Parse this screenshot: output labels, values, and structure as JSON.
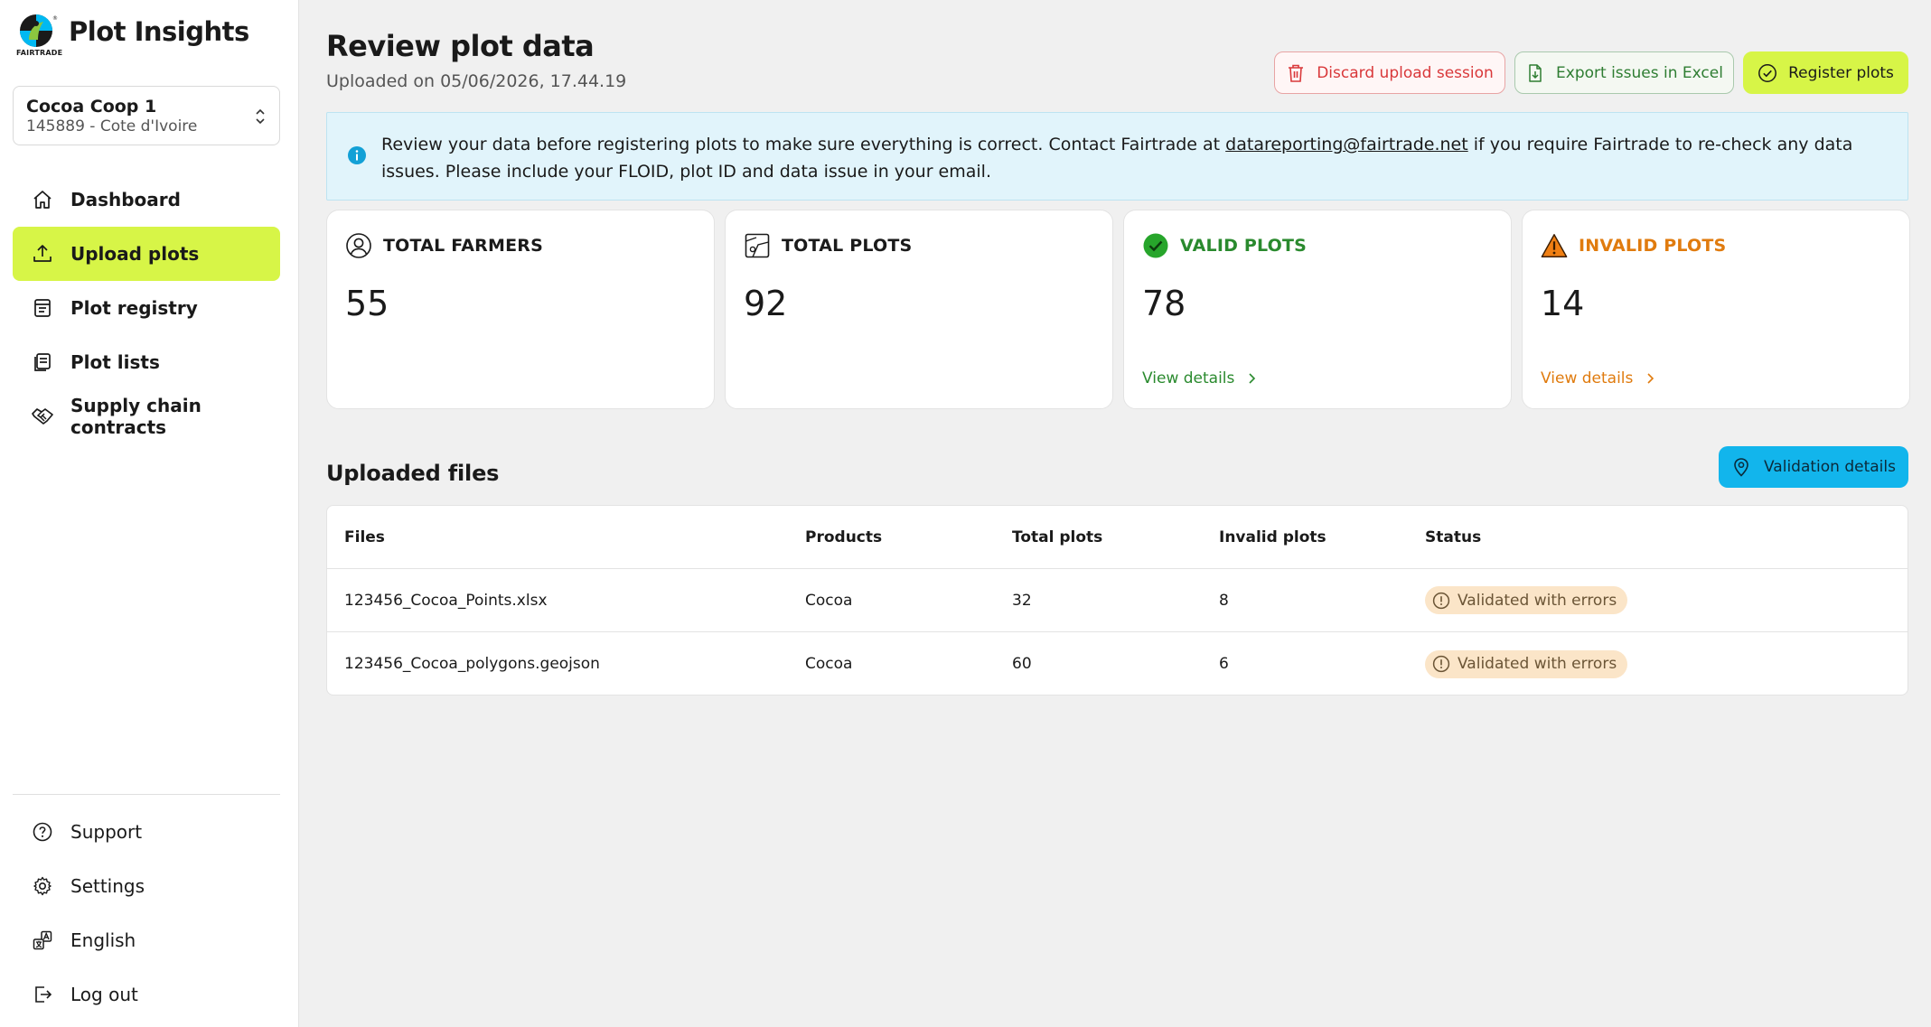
{
  "app": {
    "title": "Plot Insights",
    "logo_text": "FAIRTRADE"
  },
  "organization": {
    "name": "Cocoa Coop 1",
    "subtitle": "145889 - Cote d'Ivoire"
  },
  "sidebar": {
    "items": [
      {
        "label": "Dashboard",
        "icon": "home-icon",
        "active": false
      },
      {
        "label": "Upload plots",
        "icon": "upload-icon",
        "active": true
      },
      {
        "label": "Plot registry",
        "icon": "registry-icon",
        "active": false
      },
      {
        "label": "Plot lists",
        "icon": "lists-icon",
        "active": false
      },
      {
        "label": "Supply chain contracts",
        "icon": "handshake-icon",
        "active": false
      }
    ],
    "bottom_items": [
      {
        "label": "Support",
        "icon": "help-icon"
      },
      {
        "label": "Settings",
        "icon": "gear-icon"
      },
      {
        "label": "English",
        "icon": "language-icon"
      },
      {
        "label": "Log out",
        "icon": "logout-icon"
      }
    ]
  },
  "header": {
    "title": "Review plot data",
    "subtitle": "Uploaded on 05/06/2026, 17.44.19",
    "discard_label": "Discard upload session",
    "export_label": "Export issues in Excel",
    "register_label": "Register plots"
  },
  "banner": {
    "text_before": "Review your data before registering plots to make sure everything is correct. Contact Fairtrade at ",
    "email": "datareporting@fairtrade.net",
    "text_after": " if you require Fairtrade to re-check any data issues. Please include your FLOID, plot ID and data issue in your email."
  },
  "stats": {
    "farmers": {
      "label": "TOTAL FARMERS",
      "value": "55"
    },
    "plots": {
      "label": "TOTAL PLOTS",
      "value": "92"
    },
    "valid": {
      "label": "VALID PLOTS",
      "value": "78",
      "link": "View details"
    },
    "invalid": {
      "label": "INVALID PLOTS",
      "value": "14",
      "link": "View details"
    }
  },
  "files_section": {
    "title": "Uploaded files",
    "validation_button": "Validation details",
    "columns": [
      "Files",
      "Products",
      "Total plots",
      "Invalid plots",
      "Status"
    ],
    "rows": [
      {
        "file": "123456_Cocoa_Points.xlsx",
        "product": "Cocoa",
        "total": "32",
        "invalid": "8",
        "status": "Validated with errors"
      },
      {
        "file": "123456_Cocoa_polygons.geojson",
        "product": "Cocoa",
        "total": "60",
        "invalid": "6",
        "status": "Validated with errors"
      }
    ]
  },
  "colors": {
    "accent": "#d7f547",
    "info_bg": "#e1f4fb",
    "valid": "#2a8a2e",
    "invalid": "#e07b0e",
    "danger": "#d9383a",
    "validation_button": "#12b5ec",
    "status_badge_bg": "#fbe5c8"
  }
}
